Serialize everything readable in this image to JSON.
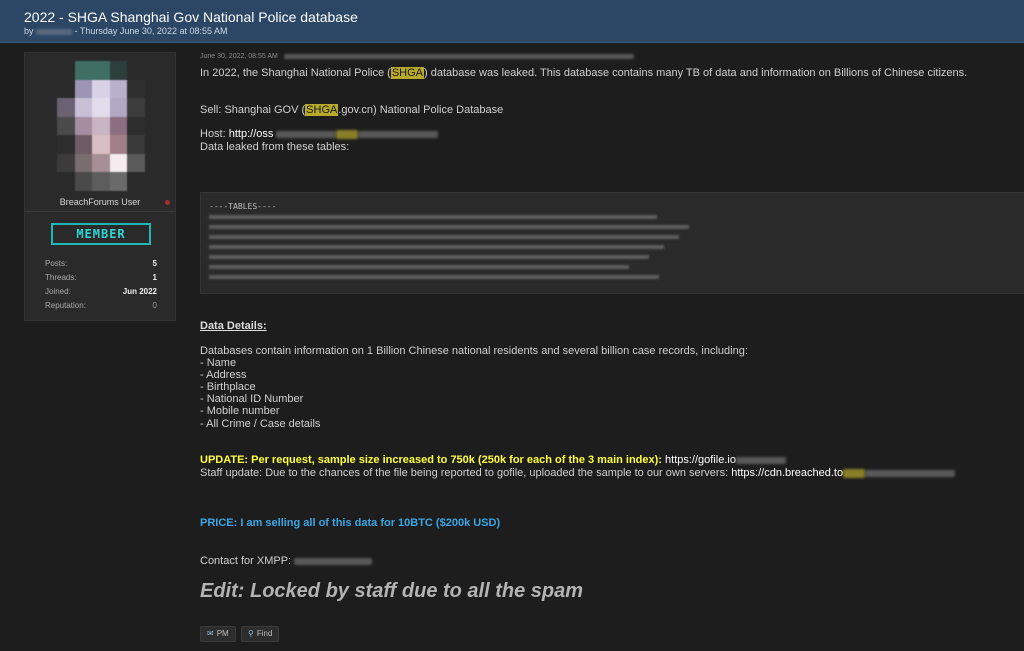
{
  "thread": {
    "title": "2022 - SHGA Shanghai Gov National Police database",
    "byline_prefix": "by",
    "byline_date": "- Thursday June 30, 2022 at 08:55 AM"
  },
  "author": {
    "role_label": "BreachForums User",
    "rank": "MEMBER",
    "stats": [
      {
        "label": "Posts:",
        "value": "5"
      },
      {
        "label": "Threads:",
        "value": "1"
      },
      {
        "label": "Joined:",
        "value": "Jun 2022"
      },
      {
        "label": "Reputation:",
        "value": "0"
      }
    ]
  },
  "post": {
    "date": "June 30, 2022, 08:55 AM",
    "intro_pre": "In 2022, the Shanghai National Police (",
    "intro_hl": "SHGA",
    "intro_post": ") database was leaked. This database contains many TB of data and information on Billions of Chinese citizens.",
    "sell_pre": "Sell: Shanghai GOV (",
    "sell_hl": "SHGA",
    "sell_post": ".gov.cn) National Police Database",
    "host_label": "Host: ",
    "host_value": "http://oss",
    "tables_text": "Data leaked from these tables:",
    "code_title": "----TABLES----",
    "details_heading": "Data Details:",
    "details_intro": "Databases contain information on 1 Billion Chinese national residents and several billion case records, including:",
    "details_items": [
      "- Name",
      "- Address",
      "- Birthplace",
      "- National ID Number",
      "- Mobile number",
      "- All Crime / Case details"
    ],
    "update_label": "UPDATE: Per request, sample size increased to 750k (250k for each of the 3 main index):",
    "update_link": " https://gofile.io",
    "staff_update": "Staff update: Due to the chances of the file being reported to gofile, uploaded the sample to our own servers:",
    "staff_link": " https://cdn.breached.to",
    "price": "PRICE: I am selling all of this data for 10BTC ($200k USD)",
    "contact": "Contact for XMPP:",
    "edit": "Edit: Locked by staff due to all the spam"
  },
  "actions": {
    "pm": "PM",
    "find": "Find"
  },
  "icons": {
    "pm": "envelope-icon",
    "find": "search-icon"
  },
  "colors": {
    "header_bg": "#2b4765",
    "highlight": "#b8a92b",
    "update": "#ffff3d",
    "price": "#3aa6e6",
    "rank": "#1fb7b5"
  }
}
